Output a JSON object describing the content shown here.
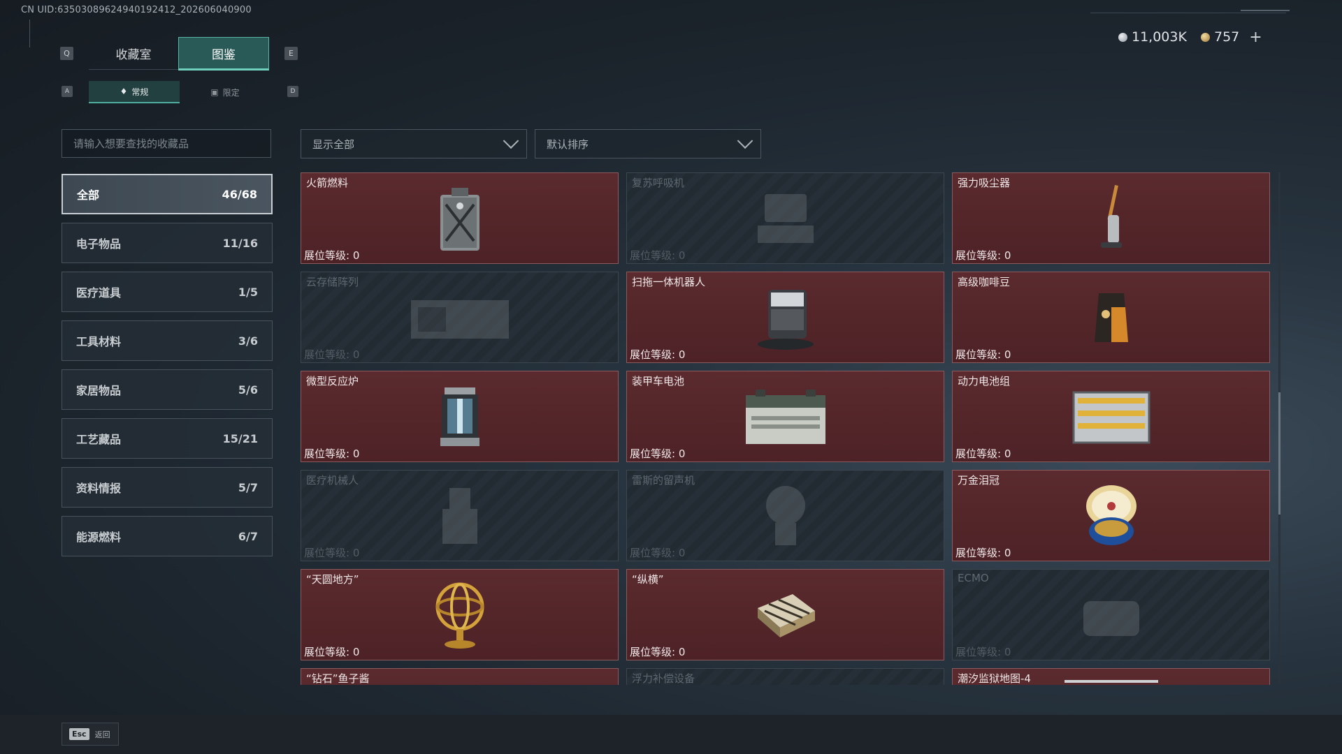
{
  "uid_text": "CN UID:6350308962494019​2412_202606040900",
  "currency": {
    "silver": "11,003K",
    "gold": "757",
    "plus": "+"
  },
  "keys": {
    "q": "Q",
    "e": "E",
    "a": "A",
    "d": "D"
  },
  "tabs": [
    {
      "label": "收藏室"
    },
    {
      "label": "图鉴"
    }
  ],
  "subtabs": [
    {
      "label": "常规"
    },
    {
      "label": "限定"
    }
  ],
  "search": {
    "placeholder": "请输入想要查找的收藏品"
  },
  "filters": {
    "show": "显示全部",
    "sort": "默认排序"
  },
  "categories": [
    {
      "label": "全部",
      "count": "46/68"
    },
    {
      "label": "电子物品",
      "count": "11/16"
    },
    {
      "label": "医疗道具",
      "count": "1/5"
    },
    {
      "label": "工具材料",
      "count": "3/6"
    },
    {
      "label": "家居物品",
      "count": "5/6"
    },
    {
      "label": "工艺藏品",
      "count": "15/21"
    },
    {
      "label": "资料情报",
      "count": "5/7"
    },
    {
      "label": "能源燃料",
      "count": "6/7"
    }
  ],
  "level_label": "展位等级: 0",
  "items": [
    {
      "name": "火箭燃料",
      "icon": "fuel-can-icon"
    },
    {
      "name": "复苏呼吸机",
      "icon": "ventilator-icon"
    },
    {
      "name": "强力吸尘器",
      "icon": "vacuum-icon"
    },
    {
      "name": "云存储阵列",
      "icon": "storage-array-icon"
    },
    {
      "name": "扫拖一体机器人",
      "icon": "robot-vacuum-icon"
    },
    {
      "name": "高级咖啡豆",
      "icon": "coffee-bag-icon"
    },
    {
      "name": "微型反应炉",
      "icon": "reactor-icon"
    },
    {
      "name": "装甲车电池",
      "icon": "car-battery-icon"
    },
    {
      "name": "动力电池组",
      "icon": "battery-pack-icon"
    },
    {
      "name": "医疗机械人",
      "icon": "medical-robot-icon"
    },
    {
      "name": "雷斯的留声机",
      "icon": "gramophone-icon"
    },
    {
      "name": "万金泪冠",
      "icon": "jeweled-egg-icon"
    },
    {
      "name": "“天圆地方”",
      "icon": "armillary-sphere-icon"
    },
    {
      "name": "“纵横”",
      "icon": "chess-box-icon"
    },
    {
      "name": "ECMO",
      "icon": "ecmo-icon"
    },
    {
      "name": "“钻石”鱼子酱",
      "icon": "caviar-icon"
    },
    {
      "name": "浮力补偿设备",
      "icon": "bcd-icon"
    },
    {
      "name": "潮汐监狱地图-4",
      "icon": "map-icon"
    }
  ],
  "bottom": {
    "esc_key": "Esc",
    "esc_label": "返回"
  }
}
